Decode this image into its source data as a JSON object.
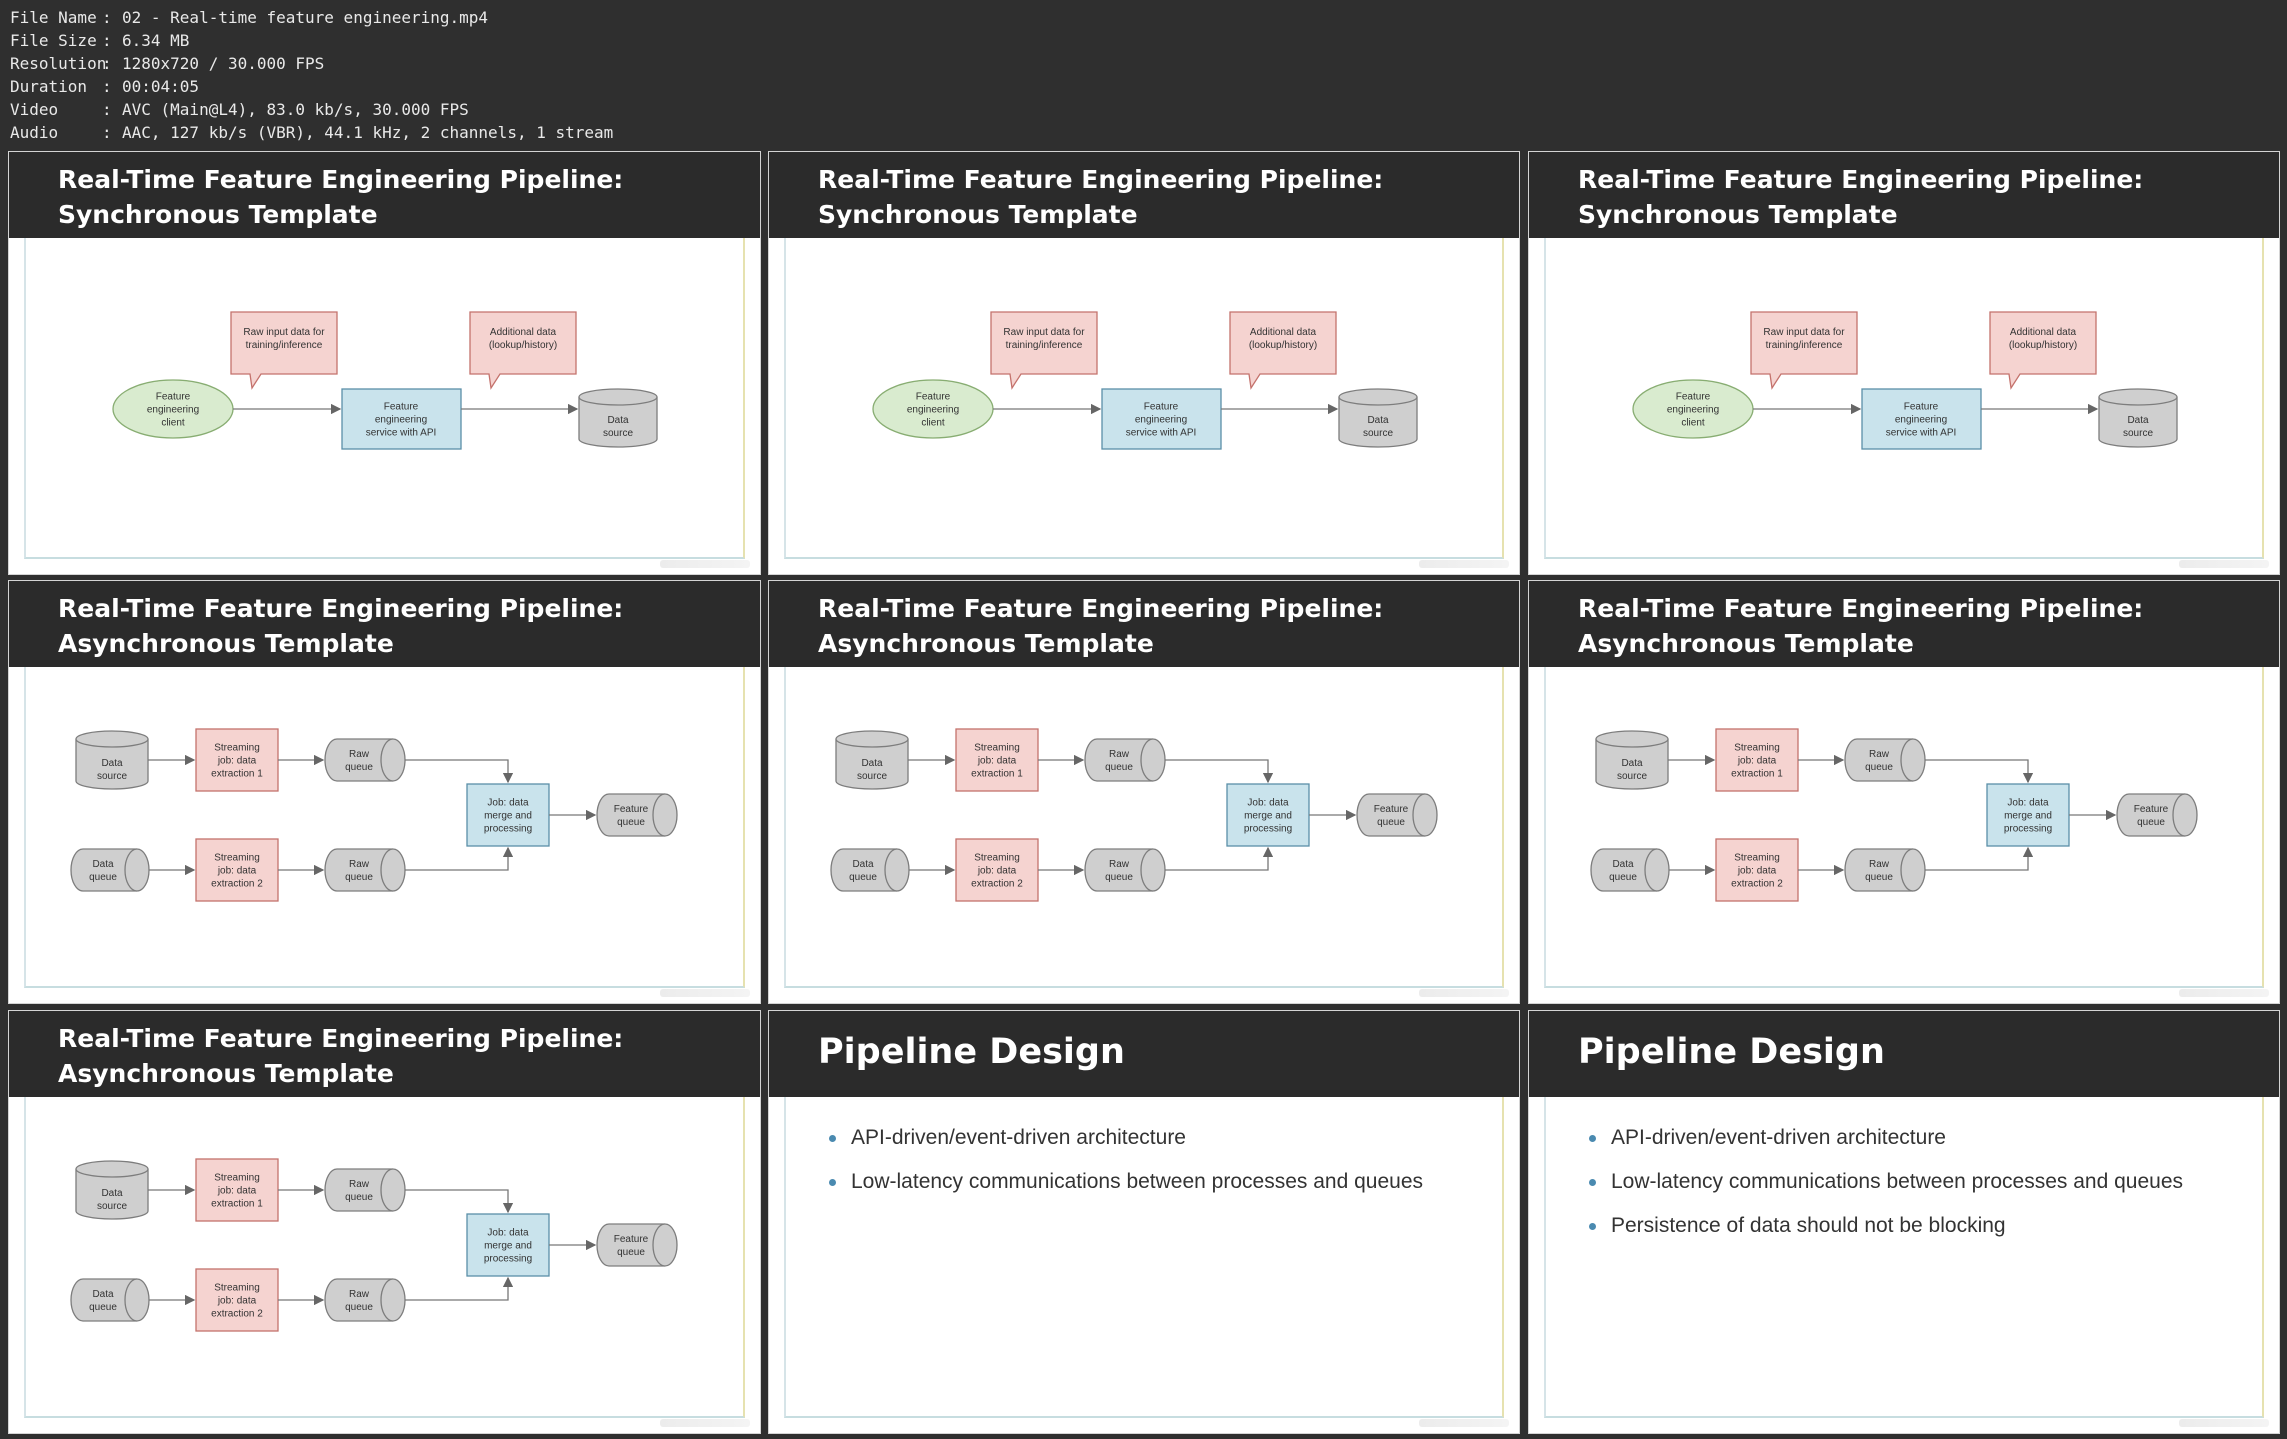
{
  "meta": [
    {
      "key": "File Name",
      "value": "02 - Real-time feature engineering.mp4"
    },
    {
      "key": "File Size",
      "value": "6.34 MB"
    },
    {
      "key": "Resolution",
      "value": "1280x720 / 30.000 FPS"
    },
    {
      "key": "Duration",
      "value": "00:04:05"
    },
    {
      "key": "Video",
      "value": "AVC (Main@L4), 83.0 kb/s, 30.000 FPS"
    },
    {
      "key": "Audio",
      "value": "AAC, 127 kb/s (VBR), 44.1 kHz, 2 channels, 1 stream"
    }
  ],
  "sync": {
    "title_line1": "Real-Time Feature Engineering Pipeline:",
    "title_line2": "Synchronous Template",
    "callout_raw": [
      "Raw input data for",
      "training/inference"
    ],
    "callout_additional": [
      "Additional data",
      "(lookup/history)"
    ],
    "client": [
      "Feature",
      "engineering",
      "client"
    ],
    "service": [
      "Feature",
      "engineering",
      "service with API"
    ],
    "source": [
      "Data",
      "source"
    ]
  },
  "async": {
    "title_line1": "Real-Time Feature Engineering Pipeline:",
    "title_line2": "Asynchronous Template",
    "data_source": [
      "Data",
      "source"
    ],
    "data_queue": [
      "Data",
      "queue"
    ],
    "job1": [
      "Streaming",
      "job: data",
      "extraction 1"
    ],
    "job2": [
      "Streaming",
      "job: data",
      "extraction 2"
    ],
    "raw_queue": [
      "Raw",
      "queue"
    ],
    "merge": [
      "Job: data",
      "merge and",
      "processing"
    ],
    "feature_queue": [
      "Feature",
      "queue"
    ]
  },
  "design": {
    "title": "Pipeline Design",
    "bullets": [
      "API-driven/event-driven architecture",
      "Low-latency communications between processes and queues",
      "Persistence of data should not be blocking"
    ]
  },
  "colors": {
    "pink_fill": "#f5d3d0",
    "pink_stroke": "#c4726c",
    "blue_fill": "#c9e3ec",
    "blue_stroke": "#5a8fa8",
    "green_fill": "#d9ebcf",
    "green_stroke": "#88ad72",
    "gray_fill": "#cfcfcf",
    "gray_stroke": "#7d7d7d",
    "bullet": "#4a8ab0"
  },
  "tiles": [
    {
      "kind": "sync"
    },
    {
      "kind": "sync"
    },
    {
      "kind": "sync"
    },
    {
      "kind": "async"
    },
    {
      "kind": "async"
    },
    {
      "kind": "async"
    },
    {
      "kind": "async"
    },
    {
      "kind": "design",
      "bullet_count": 2
    },
    {
      "kind": "design",
      "bullet_count": 3
    }
  ]
}
